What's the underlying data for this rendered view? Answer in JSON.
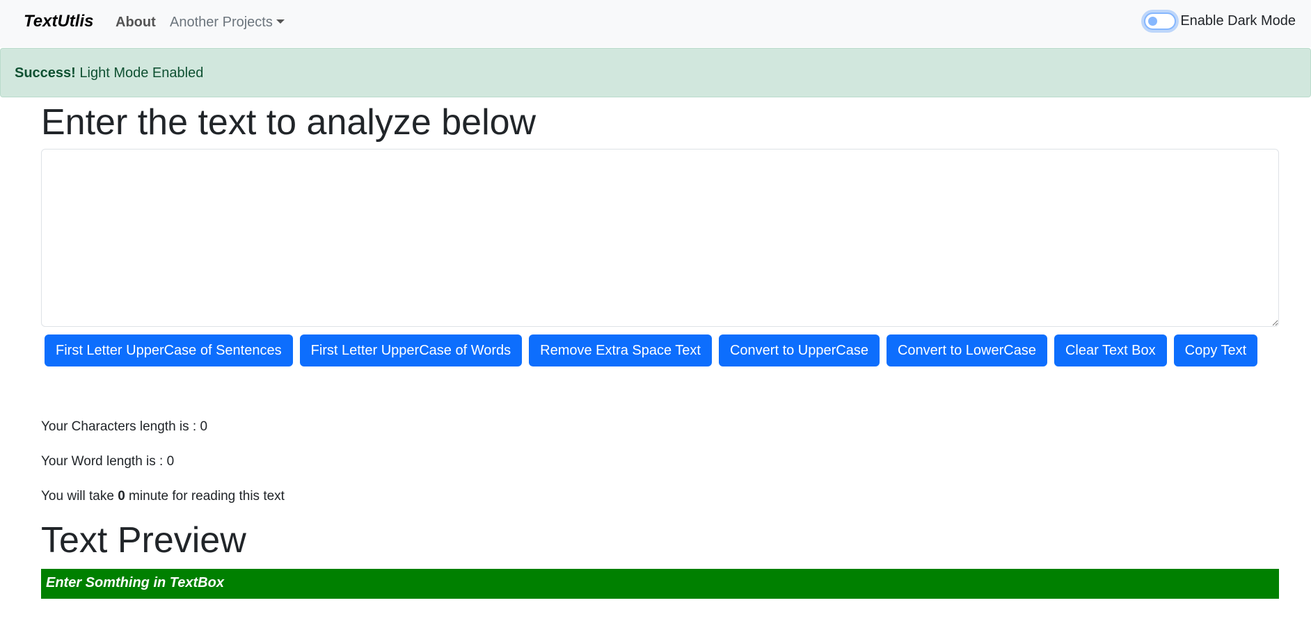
{
  "navbar": {
    "brand": "TextUtlis",
    "about": "About",
    "projects": "Another Projects",
    "dark_mode_label": "Enable Dark Mode"
  },
  "alert": {
    "title": "Success!",
    "message": "Light Mode Enabled"
  },
  "main": {
    "heading": "Enter the text to analyze below",
    "textbox_value": "",
    "buttons": [
      "First Letter UpperCase of Sentences",
      "First Letter UpperCase of Words",
      "Remove Extra Space Text",
      "Convert to UpperCase",
      "Convert to LowerCase",
      "Clear Text Box",
      "Copy Text"
    ]
  },
  "summary": {
    "characters": "Your Characters length is : 0",
    "words": "Your Word length is : 0",
    "reading_prefix": "You will take ",
    "reading_minutes": "0",
    "reading_suffix": " minute for reading this text"
  },
  "preview": {
    "heading": "Text Preview",
    "content": "Enter Somthing in TextBox"
  },
  "colors": {
    "primary": "#0d6efd",
    "success_bg": "#d1e7dd",
    "success_text": "#0f5132",
    "preview_bg": "#008000"
  }
}
